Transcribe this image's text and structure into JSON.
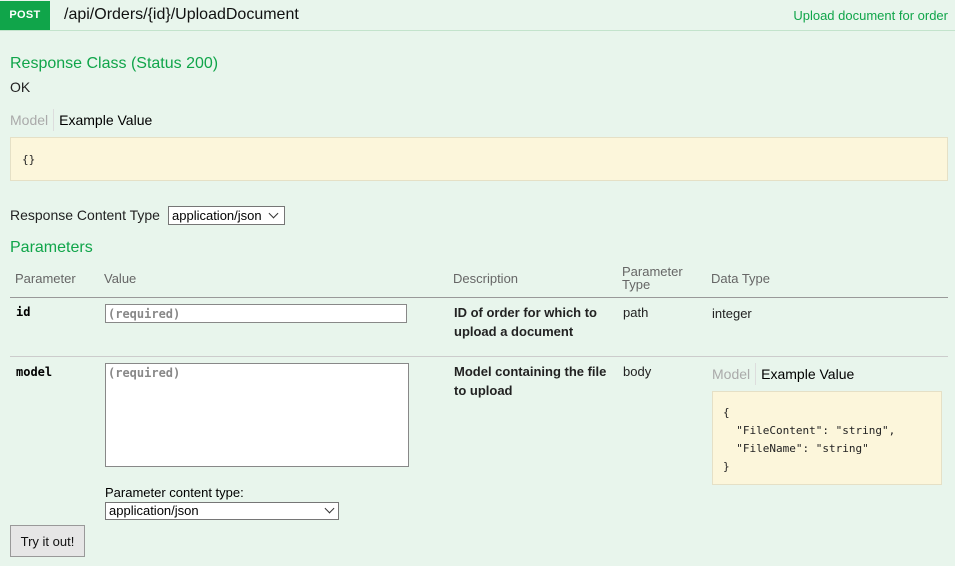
{
  "operation": {
    "method": "POST",
    "path": "/api/Orders/{id}/UploadDocument",
    "summary": "Upload document for order"
  },
  "response_class": {
    "heading": "Response Class (Status 200)",
    "status_text": "OK",
    "tabs": {
      "model": "Model",
      "example": "Example Value"
    },
    "example_value": "{}"
  },
  "response_content_type": {
    "label": "Response Content Type",
    "selected": "application/json"
  },
  "parameters": {
    "heading": "Parameters",
    "columns": {
      "parameter": "Parameter",
      "value": "Value",
      "description": "Description",
      "parameter_type": "Parameter\nType",
      "data_type": "Data Type"
    },
    "rows": [
      {
        "name": "id",
        "placeholder": "(required)",
        "description": "ID of order for which to upload a document",
        "param_type": "path",
        "data_type": "integer"
      },
      {
        "name": "model",
        "placeholder": "(required)",
        "description": "Model containing the file to upload",
        "param_type": "body",
        "data_type_tabs": {
          "model": "Model",
          "example": "Example Value"
        },
        "example_lines": [
          "{",
          "  \"FileContent\": \"string\",",
          "  \"FileName\": \"string\"",
          "}"
        ],
        "content_type_label": "Parameter content type:",
        "content_type_selected": "application/json"
      }
    ]
  },
  "try_button": "Try it out!"
}
